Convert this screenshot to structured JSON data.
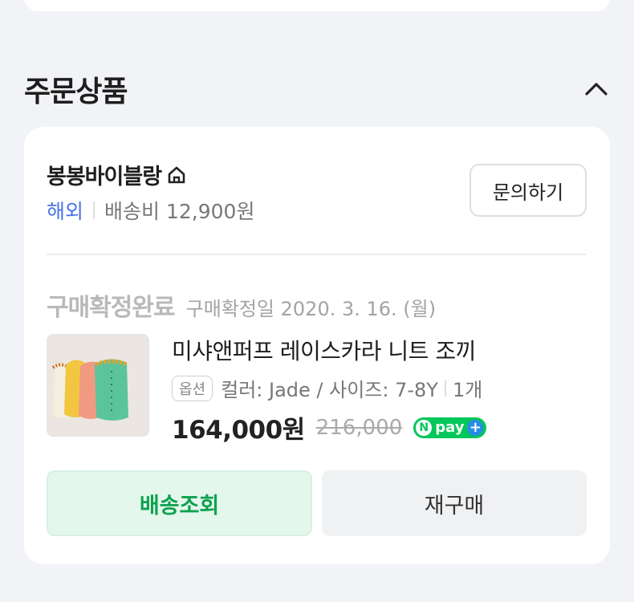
{
  "section": {
    "title": "주문상품"
  },
  "seller": {
    "name": "봉봉바이블랑",
    "overseas_label": "해외",
    "shipping_fee": "배송비 12,900원",
    "inquiry_label": "문의하기"
  },
  "order": {
    "status": "구매확정완료",
    "confirm_date": "구매확정일 2020. 3. 16. (월)",
    "product_name": "미샤앤퍼프 레이스카라 니트 조끼",
    "option_badge": "옵션",
    "option_text": "컬러: Jade / 사이즈: 7-8Y",
    "quantity": "1개",
    "price": "164,000원",
    "original_price": "216,000",
    "npay_label": "pay"
  },
  "buttons": {
    "track": "배송조회",
    "rebuy": "재구매"
  },
  "colors": {
    "accent_green": "#0fa14f",
    "npay_green": "#03c75a",
    "link_blue": "#4a73e8"
  }
}
